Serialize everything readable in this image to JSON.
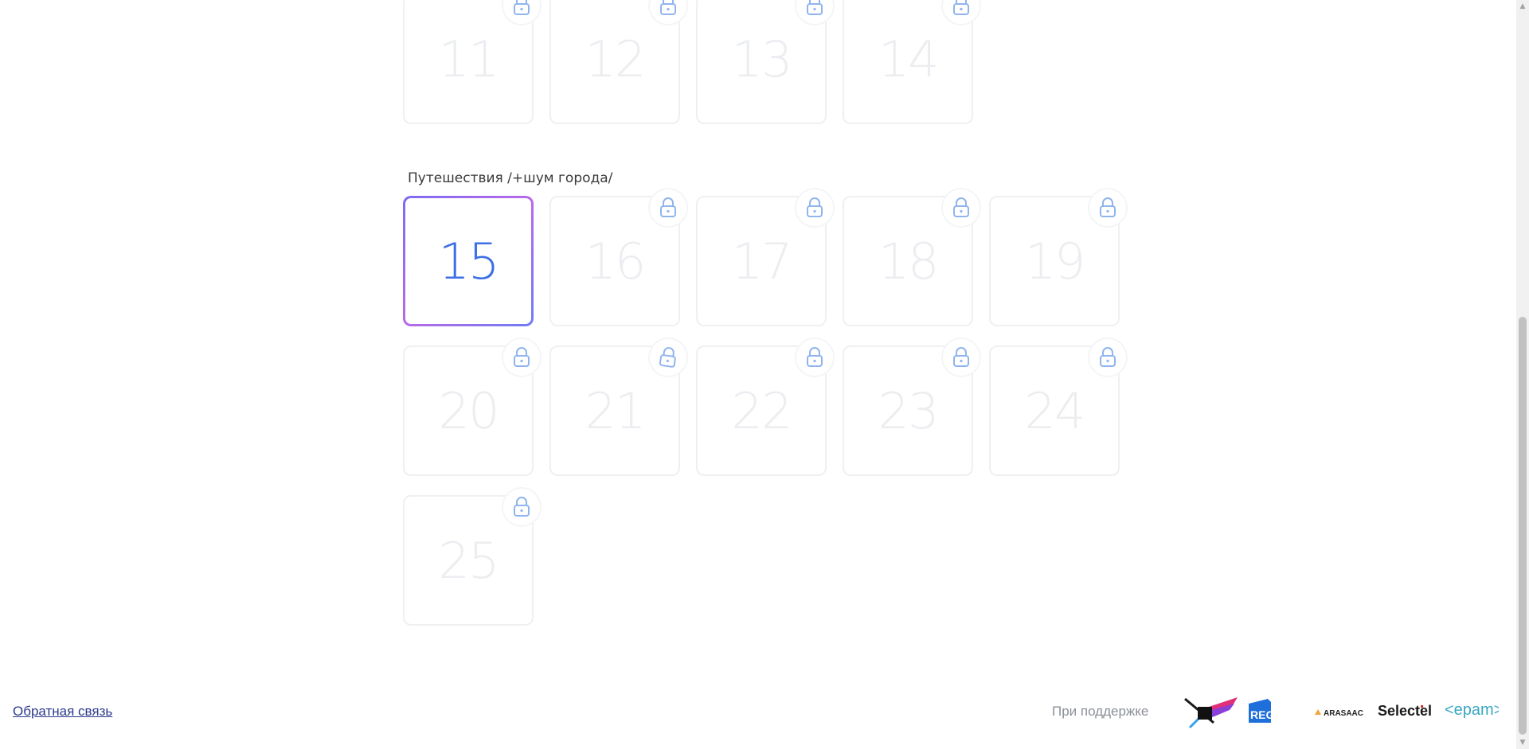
{
  "sections": [
    {
      "title": "",
      "tiles": [
        "11",
        "12",
        "13",
        "14"
      ],
      "locked": [
        true,
        true,
        true,
        true
      ]
    },
    {
      "title": "Путешествия /+шум города/",
      "tiles": [
        "15",
        "16",
        "17",
        "18",
        "19",
        "20",
        "21",
        "22",
        "23",
        "24",
        "25"
      ],
      "active": "15"
    }
  ],
  "footer": {
    "feedback_label": "Обратная связь",
    "support_label": "При поддержке",
    "sponsors": {
      "regru": "REG.RU",
      "arasaac": "ARASAAC",
      "selectel": "Selectel",
      "epam": "<epam>"
    }
  },
  "colors": {
    "accent_number": "#3c6ee6",
    "active_border_gradient": [
      "#7d6bf0",
      "#b86ae8",
      "#6e7df0"
    ],
    "lock_icon": "#8fb4ee",
    "tile_number_locked": "#ecedf0"
  },
  "icons": {
    "lock": "lock-icon",
    "scroll_up": "arrow-up-icon",
    "scroll_down": "arrow-down-icon"
  }
}
